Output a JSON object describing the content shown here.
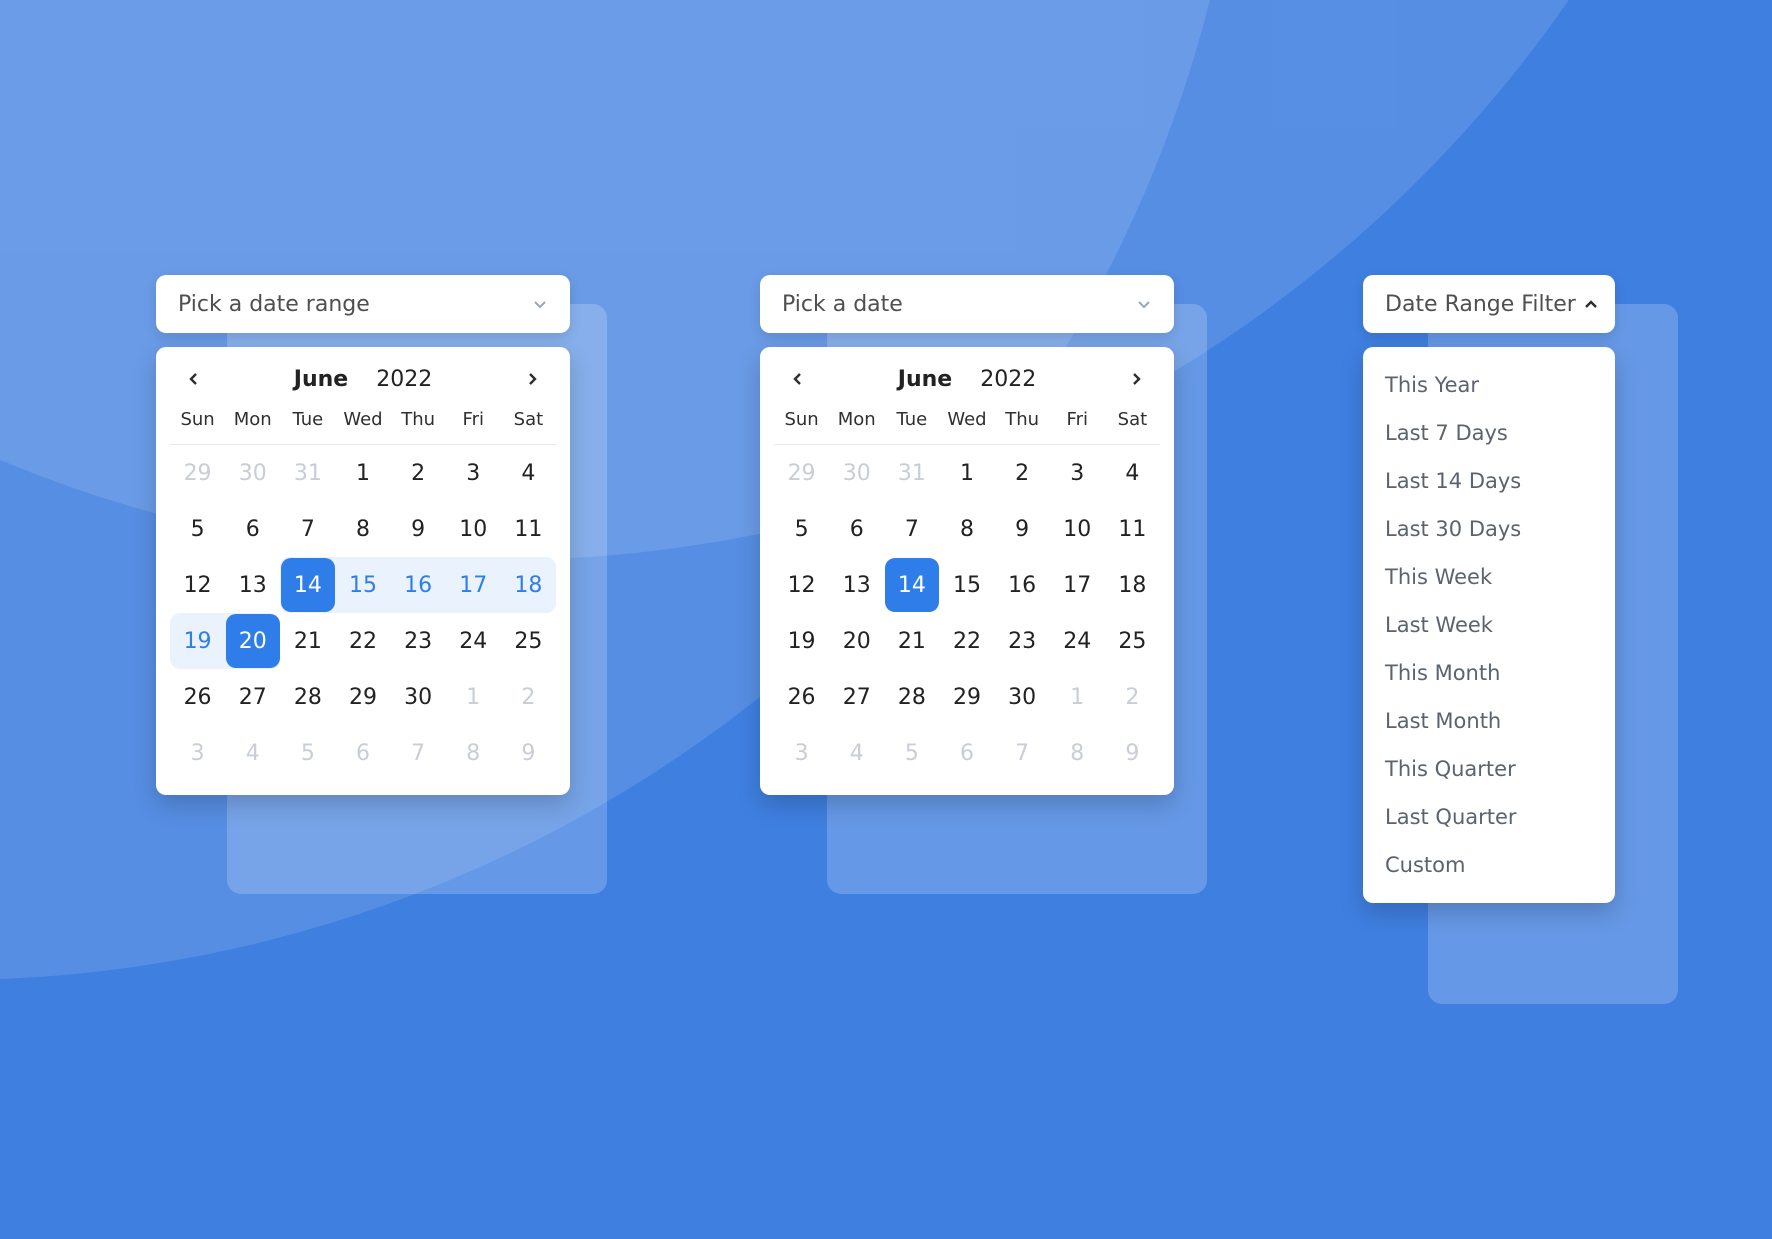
{
  "colors": {
    "accent": "#2f7de8",
    "muted": "#c8cdd6",
    "rangebg": "#eaf2fd"
  },
  "calendar": {
    "month": "June",
    "year": "2022",
    "dow": [
      "Sun",
      "Mon",
      "Tue",
      "Wed",
      "Thu",
      "Fri",
      "Sat"
    ],
    "cells": [
      {
        "n": "29",
        "out": true
      },
      {
        "n": "30",
        "out": true
      },
      {
        "n": "31",
        "out": true
      },
      {
        "n": "1"
      },
      {
        "n": "2"
      },
      {
        "n": "3"
      },
      {
        "n": "4"
      },
      {
        "n": "5"
      },
      {
        "n": "6"
      },
      {
        "n": "7"
      },
      {
        "n": "8"
      },
      {
        "n": "9"
      },
      {
        "n": "10"
      },
      {
        "n": "11"
      },
      {
        "n": "12"
      },
      {
        "n": "13"
      },
      {
        "n": "14"
      },
      {
        "n": "15"
      },
      {
        "n": "16"
      },
      {
        "n": "17"
      },
      {
        "n": "18"
      },
      {
        "n": "19"
      },
      {
        "n": "20"
      },
      {
        "n": "21"
      },
      {
        "n": "22"
      },
      {
        "n": "23"
      },
      {
        "n": "24"
      },
      {
        "n": "25"
      },
      {
        "n": "26"
      },
      {
        "n": "27"
      },
      {
        "n": "28"
      },
      {
        "n": "29"
      },
      {
        "n": "30"
      },
      {
        "n": "1",
        "out": true
      },
      {
        "n": "2",
        "out": true
      },
      {
        "n": "3",
        "out": true
      },
      {
        "n": "4",
        "out": true
      },
      {
        "n": "5",
        "out": true
      },
      {
        "n": "6",
        "out": true
      },
      {
        "n": "7",
        "out": true
      },
      {
        "n": "8",
        "out": true
      },
      {
        "n": "9",
        "out": true
      }
    ]
  },
  "range_picker": {
    "placeholder": "Pick a date range",
    "start": "14",
    "end": "20",
    "range_start_index": 16,
    "range_end_index": 22
  },
  "single_picker": {
    "placeholder": "Pick a date",
    "selected": "14",
    "selected_index": 16
  },
  "filter": {
    "label": "Date Range Filter",
    "options": [
      "This Year",
      "Last 7 Days",
      "Last 14 Days",
      "Last 30 Days",
      "This Week",
      "Last Week",
      "This Month",
      "Last Month",
      "This Quarter",
      "Last Quarter",
      "Custom"
    ]
  }
}
